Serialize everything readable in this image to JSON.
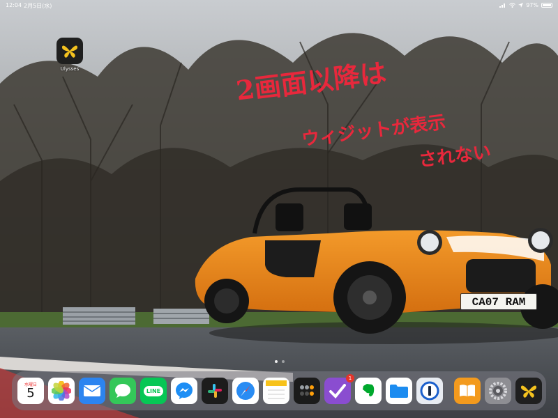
{
  "status_bar": {
    "time": "12:04",
    "date": "2月5日(水)",
    "battery": "97%",
    "battery_level": 0.97
  },
  "home_apps": [
    {
      "label": "Ulysses",
      "icon": "butterfly-icon",
      "color": "#1f1f1f"
    }
  ],
  "annotation": {
    "line1": "2画面以降は",
    "line2": "ウィジットが表示",
    "line3": "されない"
  },
  "license_plate": "CA07 RAM",
  "page_indicator": {
    "pages": 2,
    "current": 1
  },
  "dock": {
    "calendar": {
      "weekday": "水曜日",
      "day": "5"
    },
    "apps": [
      {
        "name": "photos",
        "icon": "photos-icon",
        "color": "#ffffff"
      },
      {
        "name": "mail",
        "icon": "mail-icon",
        "color": "#2c84f0"
      },
      {
        "name": "messages",
        "icon": "message-bubble-icon",
        "color": "#34c759"
      },
      {
        "name": "line",
        "icon": "line-icon",
        "color": "#06c755",
        "text": "LINE"
      },
      {
        "name": "messenger",
        "icon": "messenger-icon",
        "color": "#ffffff"
      },
      {
        "name": "slack",
        "icon": "slack-icon",
        "color": "#1c1c1c"
      },
      {
        "name": "safari",
        "icon": "compass-icon",
        "color": "#2a8cf3"
      },
      {
        "name": "notes",
        "icon": "notes-icon",
        "color": "#fefefe"
      },
      {
        "name": "calculator",
        "icon": "calculator-icon",
        "color": "#1b1b1b"
      },
      {
        "name": "omnifocus",
        "icon": "checkmark-icon",
        "color": "#8a4dd0",
        "badge": "1"
      },
      {
        "name": "evernote",
        "icon": "elephant-icon",
        "color": "#ffffff"
      },
      {
        "name": "files",
        "icon": "folder-icon",
        "color": "#ffffff"
      },
      {
        "name": "1password",
        "icon": "keyhole-icon",
        "color": "#e8ecf2"
      },
      {
        "name": "books",
        "icon": "book-icon",
        "color": "#f39a1d"
      },
      {
        "name": "settings",
        "icon": "gear-icon",
        "color": "#8e8e93"
      },
      {
        "name": "ulysses",
        "icon": "butterfly-icon",
        "color": "#1f1f1f"
      }
    ]
  }
}
